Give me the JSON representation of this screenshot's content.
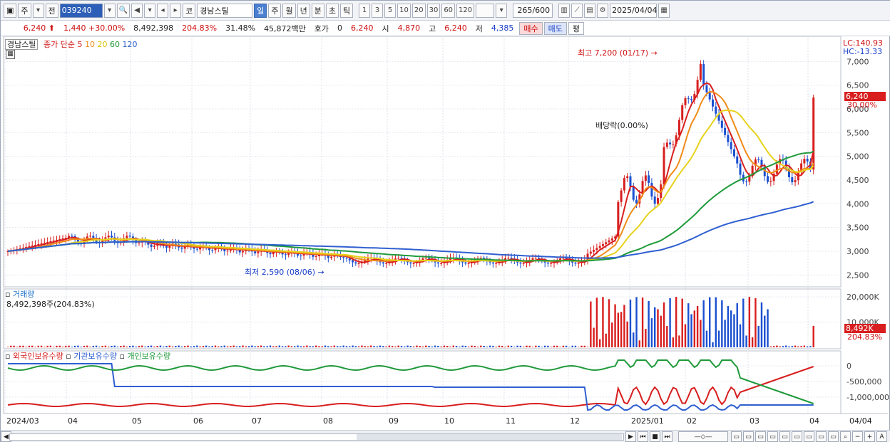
{
  "toolbar": {
    "period_label": "주",
    "prev_label": "전",
    "code": "039240",
    "name_prefix": "코",
    "stock_name": "경남스틸",
    "tabs": [
      "일",
      "주",
      "월",
      "년",
      "분",
      "초",
      "틱"
    ],
    "intervals": [
      "1",
      "3",
      "5",
      "10",
      "20",
      "30",
      "60",
      "120"
    ],
    "count": "265",
    "count_max": "/600",
    "date": "2025/04/04"
  },
  "quote": {
    "price": "6,240",
    "change": "1,440",
    "change_pct": "+30.00%",
    "volume": "8,492,398",
    "volume_ratio": "204.83%",
    "turnover": "31.48%",
    "amount": "45,872백만",
    "hoga_label": "호가",
    "hoga_value": "0",
    "open_value": "6,240",
    "open_label": "시",
    "open_price": "4,870",
    "high_label": "고",
    "high_price": "6,240",
    "low_label": "저",
    "low_price": "4,385",
    "buy_label": "매수",
    "sell_label": "매도",
    "eval_label": "평"
  },
  "price_panel": {
    "stock_label": "경남스틸",
    "ma_title": "종가 단순",
    "ma_periods": [
      {
        "label": "5",
        "color": "#d81e1e"
      },
      {
        "label": "10",
        "color": "#f08c1a"
      },
      {
        "label": "20",
        "color": "#e6d21a"
      },
      {
        "label": "60",
        "color": "#1f9a3a"
      },
      {
        "label": "120",
        "color": "#2f5fd0"
      }
    ],
    "lc": "LC:140.93",
    "hc": "HC:-13.33",
    "current_tag": "6,240",
    "current_pct": "30.00%",
    "max_label": "최고 7,200 (01/17)",
    "min_label": "최저 2,590 (08/06)",
    "dividend_label": "배당락(0.00%)"
  },
  "volume_panel": {
    "title": "거래량",
    "value": "8,492,398주(204.83%)",
    "tag": "8,492K",
    "tag_pct": "204.83%",
    "axis": [
      "20,000K",
      "10,000K"
    ]
  },
  "holding_panel": {
    "series": [
      {
        "name": "외국인보유수량",
        "color": "#d81e1e"
      },
      {
        "name": "기관보유수량",
        "color": "#2f5fd0"
      },
      {
        "name": "개인보유수량",
        "color": "#1f9a3a"
      }
    ],
    "axis": [
      "0",
      "-500,000",
      "-1,000,000"
    ]
  },
  "x_axis": [
    "2024/03",
    "04",
    "05",
    "06",
    "07",
    "08",
    "09",
    "10",
    "11",
    "12",
    "2025/01",
    "02",
    "03",
    "04",
    "04/04"
  ],
  "chart_data": {
    "type": "candlestick",
    "y_ticks": [
      7000,
      6500,
      6000,
      5500,
      5000,
      4500,
      4000,
      3500,
      3000,
      2500
    ],
    "ylim": [
      2250,
      7350
    ],
    "extremes": {
      "max": 7200,
      "min": 2590,
      "current": 6240
    }
  }
}
